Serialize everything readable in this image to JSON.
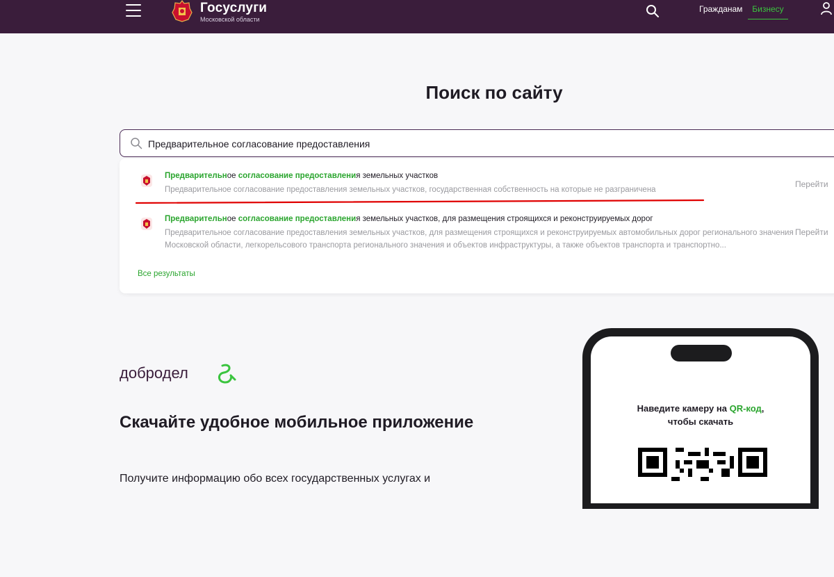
{
  "header": {
    "logo_title": "Госуслуги",
    "logo_subtitle": "Московской области",
    "nav": {
      "citizens": "Гражданам",
      "business": "Бизнесу"
    },
    "icons": [
      "menu-icon",
      "emblem-icon",
      "search-icon",
      "user-icon"
    ]
  },
  "search": {
    "title": "Поиск по сайту",
    "query": "Предварительное согласование предоставления",
    "results": [
      {
        "title_hl_1": "Предварительн",
        "title_pre_1": "ое ",
        "title_hl_2": "согласование",
        "title_mid": " ",
        "title_hl_3": "предоставлени",
        "title_rest": "я земельных участков",
        "desc": "Предварительное согласование предоставления земельных участков, государственная собственность на которые не разграничена",
        "action": "Перейти"
      },
      {
        "title_hl_1": "Предварительн",
        "title_pre_1": "ое ",
        "title_hl_2": "согласование",
        "title_mid": " ",
        "title_hl_3": "предоставлени",
        "title_rest": "я земельных участков, для размещения строящихся и реконструируемых дорог",
        "desc": "Предварительное согласование предоставления земельных участков, для размещения строящихся и реконструируемых автомобильных дорог регионального значения Московской области, легкорельсового транспорта регионального значения и объектов инфраструктуры, а также объектов транспорта и транспортно...",
        "action": "Перейти"
      }
    ],
    "all_results": "Все результаты"
  },
  "app": {
    "brand": "добродел",
    "heading": "Скачайте удобное мобильное приложение",
    "text": "Получите информацию обо всех государственных услугах и",
    "qr_caption_1": "Наведите камеру на ",
    "qr_caption_hl": "QR-код",
    "qr_caption_2": ",",
    "qr_caption_3": "чтобы скачать"
  },
  "colors": {
    "header_bg": "#3a1d3b",
    "accent_green": "#2aa52e",
    "annotation_red": "#e00000"
  }
}
